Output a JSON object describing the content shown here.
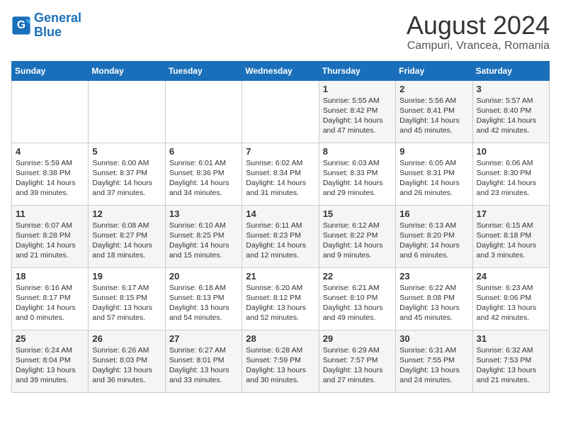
{
  "logo": {
    "line1": "General",
    "line2": "Blue"
  },
  "title": "August 2024",
  "location": "Campuri, Vrancea, Romania",
  "days_header": [
    "Sunday",
    "Monday",
    "Tuesday",
    "Wednesday",
    "Thursday",
    "Friday",
    "Saturday"
  ],
  "weeks": [
    [
      {
        "day": "",
        "content": ""
      },
      {
        "day": "",
        "content": ""
      },
      {
        "day": "",
        "content": ""
      },
      {
        "day": "",
        "content": ""
      },
      {
        "day": "1",
        "content": "Sunrise: 5:55 AM\nSunset: 8:42 PM\nDaylight: 14 hours\nand 47 minutes."
      },
      {
        "day": "2",
        "content": "Sunrise: 5:56 AM\nSunset: 8:41 PM\nDaylight: 14 hours\nand 45 minutes."
      },
      {
        "day": "3",
        "content": "Sunrise: 5:57 AM\nSunset: 8:40 PM\nDaylight: 14 hours\nand 42 minutes."
      }
    ],
    [
      {
        "day": "4",
        "content": "Sunrise: 5:59 AM\nSunset: 8:38 PM\nDaylight: 14 hours\nand 39 minutes."
      },
      {
        "day": "5",
        "content": "Sunrise: 6:00 AM\nSunset: 8:37 PM\nDaylight: 14 hours\nand 37 minutes."
      },
      {
        "day": "6",
        "content": "Sunrise: 6:01 AM\nSunset: 8:36 PM\nDaylight: 14 hours\nand 34 minutes."
      },
      {
        "day": "7",
        "content": "Sunrise: 6:02 AM\nSunset: 8:34 PM\nDaylight: 14 hours\nand 31 minutes."
      },
      {
        "day": "8",
        "content": "Sunrise: 6:03 AM\nSunset: 8:33 PM\nDaylight: 14 hours\nand 29 minutes."
      },
      {
        "day": "9",
        "content": "Sunrise: 6:05 AM\nSunset: 8:31 PM\nDaylight: 14 hours\nand 26 minutes."
      },
      {
        "day": "10",
        "content": "Sunrise: 6:06 AM\nSunset: 8:30 PM\nDaylight: 14 hours\nand 23 minutes."
      }
    ],
    [
      {
        "day": "11",
        "content": "Sunrise: 6:07 AM\nSunset: 8:28 PM\nDaylight: 14 hours\nand 21 minutes."
      },
      {
        "day": "12",
        "content": "Sunrise: 6:08 AM\nSunset: 8:27 PM\nDaylight: 14 hours\nand 18 minutes."
      },
      {
        "day": "13",
        "content": "Sunrise: 6:10 AM\nSunset: 8:25 PM\nDaylight: 14 hours\nand 15 minutes."
      },
      {
        "day": "14",
        "content": "Sunrise: 6:11 AM\nSunset: 8:23 PM\nDaylight: 14 hours\nand 12 minutes."
      },
      {
        "day": "15",
        "content": "Sunrise: 6:12 AM\nSunset: 8:22 PM\nDaylight: 14 hours\nand 9 minutes."
      },
      {
        "day": "16",
        "content": "Sunrise: 6:13 AM\nSunset: 8:20 PM\nDaylight: 14 hours\nand 6 minutes."
      },
      {
        "day": "17",
        "content": "Sunrise: 6:15 AM\nSunset: 8:18 PM\nDaylight: 14 hours\nand 3 minutes."
      }
    ],
    [
      {
        "day": "18",
        "content": "Sunrise: 6:16 AM\nSunset: 8:17 PM\nDaylight: 14 hours\nand 0 minutes."
      },
      {
        "day": "19",
        "content": "Sunrise: 6:17 AM\nSunset: 8:15 PM\nDaylight: 13 hours\nand 57 minutes."
      },
      {
        "day": "20",
        "content": "Sunrise: 6:18 AM\nSunset: 8:13 PM\nDaylight: 13 hours\nand 54 minutes."
      },
      {
        "day": "21",
        "content": "Sunrise: 6:20 AM\nSunset: 8:12 PM\nDaylight: 13 hours\nand 52 minutes."
      },
      {
        "day": "22",
        "content": "Sunrise: 6:21 AM\nSunset: 8:10 PM\nDaylight: 13 hours\nand 49 minutes."
      },
      {
        "day": "23",
        "content": "Sunrise: 6:22 AM\nSunset: 8:08 PM\nDaylight: 13 hours\nand 45 minutes."
      },
      {
        "day": "24",
        "content": "Sunrise: 6:23 AM\nSunset: 8:06 PM\nDaylight: 13 hours\nand 42 minutes."
      }
    ],
    [
      {
        "day": "25",
        "content": "Sunrise: 6:24 AM\nSunset: 8:04 PM\nDaylight: 13 hours\nand 39 minutes."
      },
      {
        "day": "26",
        "content": "Sunrise: 6:26 AM\nSunset: 8:03 PM\nDaylight: 13 hours\nand 36 minutes."
      },
      {
        "day": "27",
        "content": "Sunrise: 6:27 AM\nSunset: 8:01 PM\nDaylight: 13 hours\nand 33 minutes."
      },
      {
        "day": "28",
        "content": "Sunrise: 6:28 AM\nSunset: 7:59 PM\nDaylight: 13 hours\nand 30 minutes."
      },
      {
        "day": "29",
        "content": "Sunrise: 6:29 AM\nSunset: 7:57 PM\nDaylight: 13 hours\nand 27 minutes."
      },
      {
        "day": "30",
        "content": "Sunrise: 6:31 AM\nSunset: 7:55 PM\nDaylight: 13 hours\nand 24 minutes."
      },
      {
        "day": "31",
        "content": "Sunrise: 6:32 AM\nSunset: 7:53 PM\nDaylight: 13 hours\nand 21 minutes."
      }
    ]
  ]
}
